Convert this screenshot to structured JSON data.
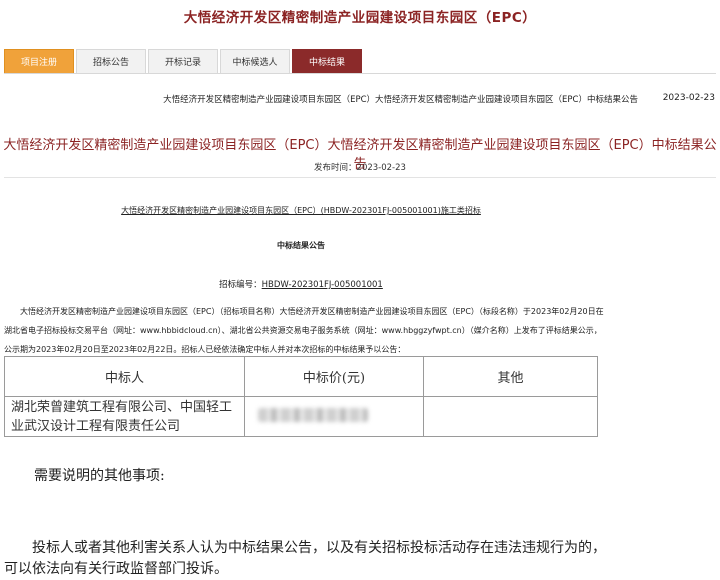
{
  "page_title": "大悟经济开发区精密制造产业园建设项目东园区（EPC）",
  "tabs": [
    {
      "label": "项目注册"
    },
    {
      "label": "招标公告"
    },
    {
      "label": "开标记录"
    },
    {
      "label": "中标候选人"
    },
    {
      "label": "中标结果"
    }
  ],
  "breadcrumb": {
    "title": "大悟经济开发区精密制造产业园建设项目东园区（EPC）大悟经济开发区精密制造产业园建设项目东园区（EPC）中标结果公告",
    "date": "2023-02-23"
  },
  "notice": {
    "heading": "大悟经济开发区精密制造产业园建设项目东园区（EPC）大悟经济开发区精密制造产业园建设项目东园区（EPC）中标结果公告",
    "publish_time": "发布时间：2023-02-23",
    "project_line": "大悟经济开发区精密制造产业园建设项目东园区（EPC）(HBDW-202301FJ-005001001)施工类招标",
    "title": "中标结果公告",
    "bid_no_label": "招标编号：",
    "bid_no": "HBDW-202301FJ-005001001",
    "paragraph": "大悟经济开发区精密制造产业园建设项目东园区（EPC）（招标项目名称）大悟经济开发区精密制造产业园建设项目东园区（EPC）（标段名称）于2023年02月20日在湖北省电子招标投标交易平台（网址：www.hbbidcloud.cn）、湖北省公共资源交易电子服务系统（网址：www.hbggzyfwpt.cn）（媒介名称）上发布了评标结果公示，公示期为2023年02月20日至2023年02月22日。招标人已经依法确定中标人并对本次招标的中标结果予以公告："
  },
  "table": {
    "headers": [
      "中标人",
      "中标价(元)",
      "其他"
    ],
    "rows": [
      {
        "winner": "湖北荣曾建筑工程有限公司、中国轻工业武汉设计工程有限责任公司",
        "price": "",
        "other": ""
      }
    ]
  },
  "other_title": "需要说明的其他事项:",
  "bottom_text": "投标人或者其他利害关系人认为中标结果公告，以及有关招标投标活动存在违法违规行为的，可以依法向有关行政监督部门投诉。"
}
